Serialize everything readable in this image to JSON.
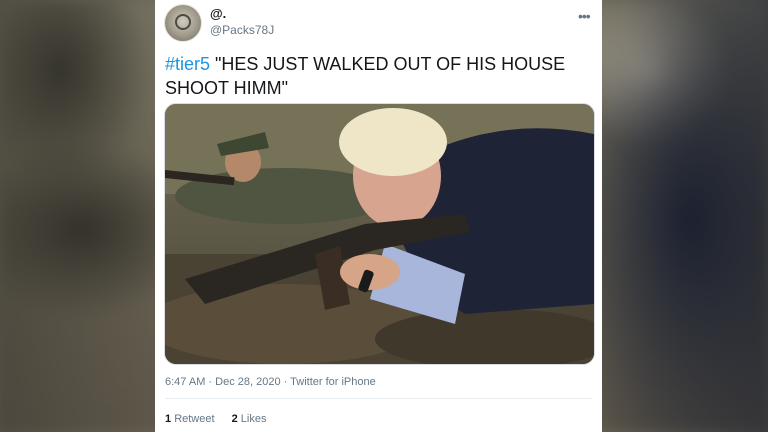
{
  "tweet": {
    "display_name": "@.",
    "handle": "@Packs78J",
    "hashtag": "#tier5",
    "text": " \"HES JUST WALKED OUT OF HIS HOUSE SHOOT HIMM\"",
    "timestamp": "6:47 AM · Dec 28, 2020 · Twitter for iPhone",
    "retweet_count": "1",
    "retweet_label": "Retweet",
    "like_count": "2",
    "like_label": "Likes",
    "more_icon": "more-horizontal-icon"
  },
  "colors": {
    "link": "#1b95e0",
    "text": "#14171a",
    "secondary": "#657786"
  }
}
